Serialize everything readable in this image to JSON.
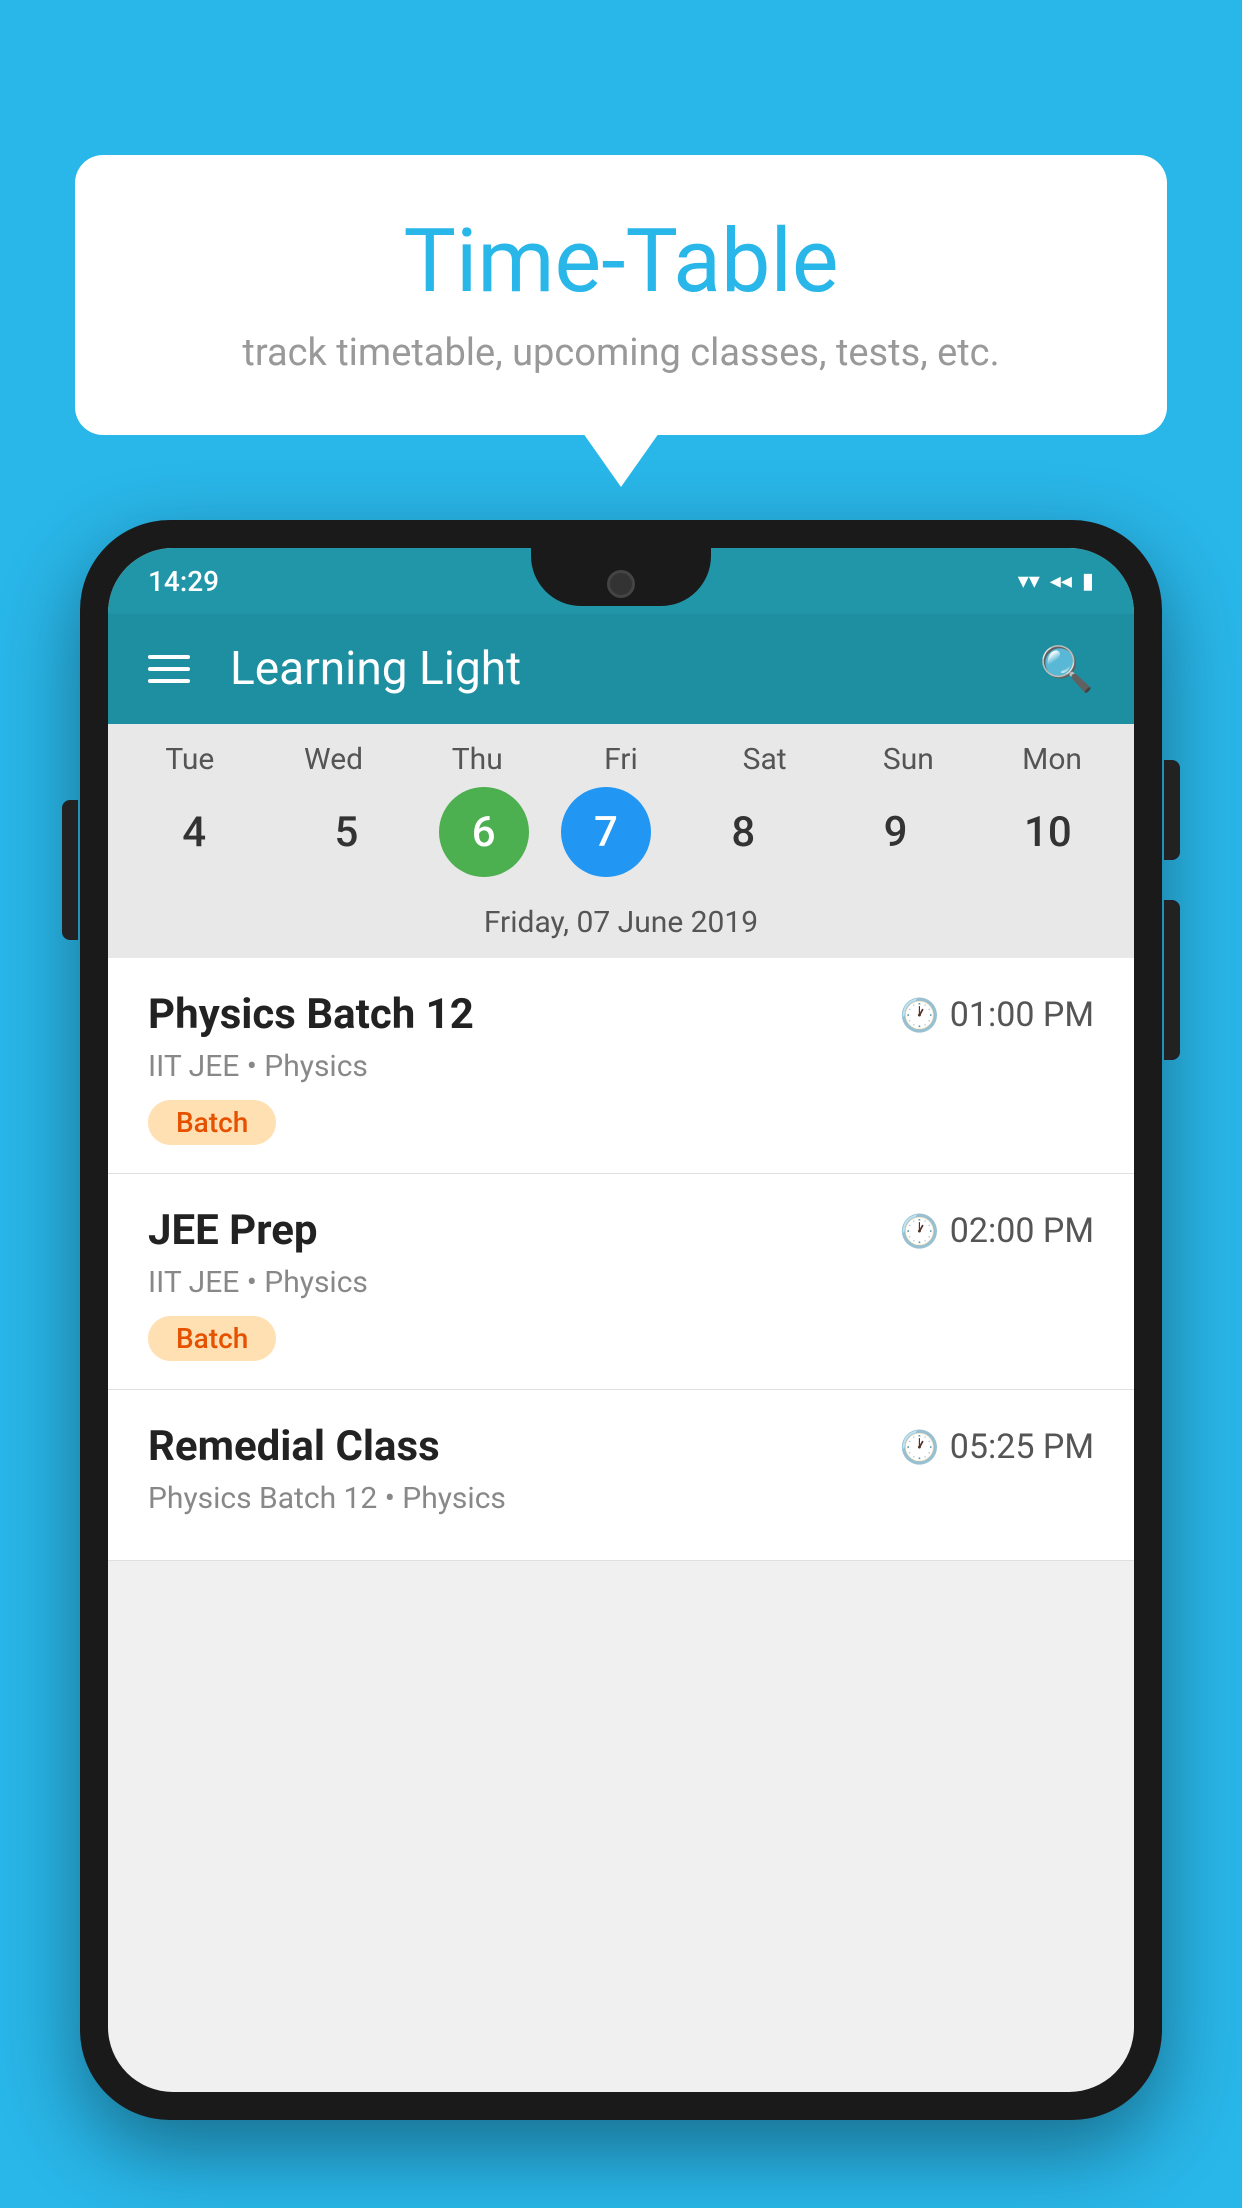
{
  "background_color": "#29B6E8",
  "speech_bubble": {
    "title": "Time-Table",
    "subtitle": "track timetable, upcoming classes, tests, etc."
  },
  "phone": {
    "status_bar": {
      "time": "14:29",
      "wifi_icon": "wifi",
      "signal_icon": "signal",
      "battery_icon": "battery"
    },
    "app_bar": {
      "title": "Learning Light",
      "menu_icon": "menu",
      "search_icon": "search"
    },
    "calendar": {
      "days": [
        {
          "label": "Tue",
          "number": "4"
        },
        {
          "label": "Wed",
          "number": "5"
        },
        {
          "label": "Thu",
          "number": "6",
          "state": "today"
        },
        {
          "label": "Fri",
          "number": "7",
          "state": "selected"
        },
        {
          "label": "Sat",
          "number": "8"
        },
        {
          "label": "Sun",
          "number": "9"
        },
        {
          "label": "Mon",
          "number": "10"
        }
      ],
      "selected_date": "Friday, 07 June 2019"
    },
    "schedule": [
      {
        "title": "Physics Batch 12",
        "time": "01:00 PM",
        "subtitle": "IIT JEE • Physics",
        "tag": "Batch"
      },
      {
        "title": "JEE Prep",
        "time": "02:00 PM",
        "subtitle": "IIT JEE • Physics",
        "tag": "Batch"
      },
      {
        "title": "Remedial Class",
        "time": "05:25 PM",
        "subtitle": "Physics Batch 12 • Physics",
        "tag": ""
      }
    ]
  }
}
